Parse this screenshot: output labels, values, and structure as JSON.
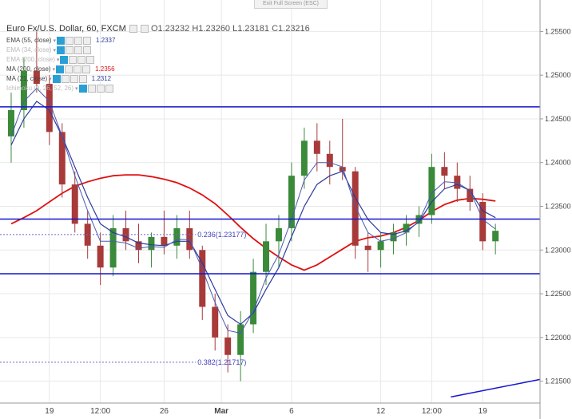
{
  "exit_fullscreen_label": "Exit Full Screen (ESC)",
  "header": {
    "symbol": "Euro Fx/U.S. Dollar, 60, FXCM",
    "open": "O1.23232",
    "high": "H1.23260",
    "low": "L1.23181",
    "close": "C1.23216"
  },
  "indicators": [
    {
      "label": "EMA (55, close)",
      "value": "1.2337",
      "value_color": "#2b3b9c",
      "faded": false
    },
    {
      "label": "EMA (34, close)",
      "value": "",
      "value_color": "#999999",
      "faded": true
    },
    {
      "label": "EMA (200, close)",
      "value": "",
      "value_color": "#999999",
      "faded": true
    },
    {
      "label": "MA (200, close)",
      "value": "1.2356",
      "value_color": "#e01010",
      "faded": false
    },
    {
      "label": "MA (21, close)",
      "value": "1.2312",
      "value_color": "#2b3b9c",
      "faded": false
    },
    {
      "label": "Ichimoku (9, 26, 52, 26)",
      "value": "",
      "value_color": "#999999",
      "faded": true
    }
  ],
  "chart_data": {
    "type": "candlestick",
    "instrument": "EUR/USD",
    "timeframe": "60",
    "ylim": [
      1.2125,
      1.2575
    ],
    "y_ticks": [
      "1.25500",
      "1.25000",
      "1.24500",
      "1.24000",
      "1.23500",
      "1.23000",
      "1.22500",
      "1.22000",
      "1.21500"
    ],
    "x_ticks": [
      {
        "label": "19",
        "bar": 3.5
      },
      {
        "label": "12:00",
        "bar": 7.5
      },
      {
        "label": "26",
        "bar": 12.5
      },
      {
        "label": "Mar",
        "bar": 17
      },
      {
        "label": "6",
        "bar": 22.5
      },
      {
        "label": "12",
        "bar": 29.5
      },
      {
        "label": "12:00",
        "bar": 33.5
      },
      {
        "label": "19",
        "bar": 37.5
      }
    ],
    "horizontal_lines": [
      {
        "value": 1.24637,
        "label": "1.24637",
        "color": "#1515d0"
      },
      {
        "value": 1.23354,
        "label": "1.23354",
        "color": "#1515d0"
      },
      {
        "value": 1.22729,
        "label": "1.22729",
        "color": "#1515d0"
      }
    ],
    "last_price": {
      "value": 1.23216,
      "label": "1.23216",
      "color": "#e01010"
    },
    "fib_levels": [
      {
        "text": "0.236(1.23177)",
        "value": 1.23177
      },
      {
        "text": "0.382(1.21717)",
        "value": 1.21717
      }
    ],
    "colors": {
      "up": "#3a8a3a",
      "down": "#a83a3a",
      "ema": "#2b3b9c",
      "ma": "#e01010"
    },
    "bar_axis": [
      0,
      42
    ],
    "candles": [
      {
        "o": 1.243,
        "h": 1.248,
        "l": 1.24,
        "c": 1.246
      },
      {
        "o": 1.246,
        "h": 1.252,
        "l": 1.244,
        "c": 1.2505
      },
      {
        "o": 1.2505,
        "h": 1.255,
        "l": 1.248,
        "c": 1.249
      },
      {
        "o": 1.249,
        "h": 1.25,
        "l": 1.242,
        "c": 1.2435
      },
      {
        "o": 1.2435,
        "h": 1.2445,
        "l": 1.236,
        "c": 1.2375
      },
      {
        "o": 1.2375,
        "h": 1.239,
        "l": 1.232,
        "c": 1.233
      },
      {
        "o": 1.233,
        "h": 1.2345,
        "l": 1.229,
        "c": 1.2305
      },
      {
        "o": 1.2305,
        "h": 1.232,
        "l": 1.226,
        "c": 1.228
      },
      {
        "o": 1.228,
        "h": 1.234,
        "l": 1.227,
        "c": 1.2325
      },
      {
        "o": 1.2325,
        "h": 1.2345,
        "l": 1.23,
        "c": 1.231
      },
      {
        "o": 1.231,
        "h": 1.233,
        "l": 1.2285,
        "c": 1.23
      },
      {
        "o": 1.23,
        "h": 1.232,
        "l": 1.228,
        "c": 1.2315
      },
      {
        "o": 1.2315,
        "h": 1.2345,
        "l": 1.2295,
        "c": 1.2305
      },
      {
        "o": 1.2305,
        "h": 1.234,
        "l": 1.229,
        "c": 1.2325
      },
      {
        "o": 1.2325,
        "h": 1.2345,
        "l": 1.229,
        "c": 1.23
      },
      {
        "o": 1.23,
        "h": 1.2305,
        "l": 1.222,
        "c": 1.2235
      },
      {
        "o": 1.2235,
        "h": 1.225,
        "l": 1.2185,
        "c": 1.22
      },
      {
        "o": 1.22,
        "h": 1.2215,
        "l": 1.216,
        "c": 1.218
      },
      {
        "o": 1.218,
        "h": 1.223,
        "l": 1.215,
        "c": 1.2215
      },
      {
        "o": 1.2215,
        "h": 1.229,
        "l": 1.2205,
        "c": 1.2275
      },
      {
        "o": 1.2275,
        "h": 1.233,
        "l": 1.226,
        "c": 1.231
      },
      {
        "o": 1.231,
        "h": 1.234,
        "l": 1.228,
        "c": 1.2325
      },
      {
        "o": 1.2325,
        "h": 1.24,
        "l": 1.231,
        "c": 1.2385
      },
      {
        "o": 1.2385,
        "h": 1.244,
        "l": 1.237,
        "c": 1.2425
      },
      {
        "o": 1.2425,
        "h": 1.2445,
        "l": 1.239,
        "c": 1.241
      },
      {
        "o": 1.241,
        "h": 1.2425,
        "l": 1.2375,
        "c": 1.2395
      },
      {
        "o": 1.2395,
        "h": 1.245,
        "l": 1.238,
        "c": 1.239
      },
      {
        "o": 1.239,
        "h": 1.2395,
        "l": 1.229,
        "c": 1.2305
      },
      {
        "o": 1.2305,
        "h": 1.232,
        "l": 1.2275,
        "c": 1.23
      },
      {
        "o": 1.23,
        "h": 1.232,
        "l": 1.228,
        "c": 1.231
      },
      {
        "o": 1.231,
        "h": 1.233,
        "l": 1.2295,
        "c": 1.232
      },
      {
        "o": 1.232,
        "h": 1.234,
        "l": 1.2305,
        "c": 1.233
      },
      {
        "o": 1.233,
        "h": 1.235,
        "l": 1.2315,
        "c": 1.234
      },
      {
        "o": 1.234,
        "h": 1.241,
        "l": 1.233,
        "c": 1.2395
      },
      {
        "o": 1.2395,
        "h": 1.2412,
        "l": 1.237,
        "c": 1.2385
      },
      {
        "o": 1.2385,
        "h": 1.24,
        "l": 1.2355,
        "c": 1.237
      },
      {
        "o": 1.237,
        "h": 1.2385,
        "l": 1.2345,
        "c": 1.2355
      },
      {
        "o": 1.2355,
        "h": 1.2365,
        "l": 1.23,
        "c": 1.231
      },
      {
        "o": 1.231,
        "h": 1.233,
        "l": 1.2295,
        "c": 1.2322
      }
    ],
    "ema": [
      1.242,
      1.245,
      1.247,
      1.246,
      1.243,
      1.2395,
      1.236,
      1.233,
      1.232,
      1.2315,
      1.2308,
      1.2306,
      1.2305,
      1.231,
      1.231,
      1.2285,
      1.2255,
      1.2225,
      1.2215,
      1.2228,
      1.2255,
      1.228,
      1.2315,
      1.235,
      1.2375,
      1.2385,
      1.239,
      1.236,
      1.2335,
      1.232,
      1.2318,
      1.2322,
      1.2332,
      1.2355,
      1.237,
      1.2375,
      1.2368,
      1.2345,
      1.2337
    ],
    "ema_fast": [
      1.243,
      1.247,
      1.2485,
      1.247,
      1.243,
      1.2385,
      1.2345,
      1.231,
      1.231,
      1.2308,
      1.2302,
      1.2304,
      1.2303,
      1.2312,
      1.2312,
      1.2278,
      1.224,
      1.2208,
      1.2205,
      1.223,
      1.2268,
      1.2295,
      1.2335,
      1.238,
      1.24,
      1.24,
      1.2395,
      1.235,
      1.232,
      1.231,
      1.2313,
      1.232,
      1.2333,
      1.2365,
      1.2378,
      1.2377,
      1.2368,
      1.2335,
      1.2324
    ],
    "ma": [
      1.233,
      1.2337,
      1.2345,
      1.2355,
      1.2365,
      1.2373,
      1.2378,
      1.2382,
      1.2385,
      1.2386,
      1.2386,
      1.2384,
      1.2381,
      1.2377,
      1.2371,
      1.2363,
      1.2353,
      1.234,
      1.2326,
      1.2313,
      1.2302,
      1.2292,
      1.2283,
      1.2277,
      1.2283,
      1.2292,
      1.2301,
      1.231,
      1.2314,
      1.2316,
      1.232,
      1.2326,
      1.2334,
      1.2344,
      1.2352,
      1.2357,
      1.2359,
      1.2358,
      1.2356
    ],
    "trendline": [
      {
        "bar": 35,
        "price": 1.2132
      },
      {
        "bar": 42,
        "price": 1.2152
      }
    ]
  }
}
